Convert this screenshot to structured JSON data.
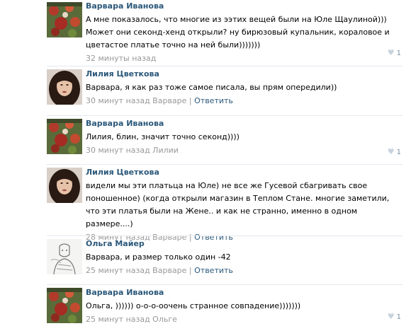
{
  "comments": [
    {
      "author": "Варвара Иванова",
      "text": "А мне показалось, что многие из ээтих вещей были на Юле Щаулиной))) Может они секонд-хенд открыли? ну бирюзовый купальник, кораловое и цветастое платье точно на ней были)))))))",
      "time": "32 минуты назад",
      "reply_to": "",
      "reply_label": "",
      "likes": "1",
      "avatar": "flowers"
    },
    {
      "author": "Лилия Цветкова",
      "text": "Варвара, я как раз тоже самое писала, вы прям опередили))",
      "time": "30 минут назад Варваре",
      "reply_to": "",
      "reply_label": "Ответить",
      "likes": "",
      "avatar": "woman"
    },
    {
      "author": "Варвара Иванова",
      "text": "Лилия, блин, значит точно секонд))))",
      "time": "30 минут назад Лилии",
      "reply_to": "",
      "reply_label": "",
      "likes": "1",
      "avatar": "flowers"
    },
    {
      "author": "Лилия Цветкова",
      "text": "видели мы эти платьца на Юле) не все же Гусевой сбагривать свое поношенное) (когда открыли магазин в Теплом Стане. многие заметили, что эти платья были на Жене.. и как не странно, именно в одном размере....)",
      "time": "28 минут назад Варваре",
      "reply_to": "",
      "reply_label": "Ответить",
      "likes": "",
      "avatar": "woman"
    },
    {
      "author": "Ольга Майер",
      "text": "Варвара, и размер только один -42",
      "time": "25 минут назад Варваре",
      "reply_to": "",
      "reply_label": "Ответить",
      "likes": "",
      "avatar": "sketch"
    },
    {
      "author": "Варвара Иванова",
      "text": "Ольга, )))))) о-о-о-оочень странное совпадение)))))))",
      "time": "25 минут назад Ольге",
      "reply_to": "",
      "reply_label": "",
      "likes": "1",
      "avatar": "flowers"
    }
  ],
  "separator": " | ",
  "colors": {
    "author": "#2b587a",
    "link": "#2b587a",
    "meta": "#999999",
    "divider": "#e4e8ed",
    "like_heart": "#c7d3de"
  },
  "icons": {
    "like": "heart-icon"
  }
}
